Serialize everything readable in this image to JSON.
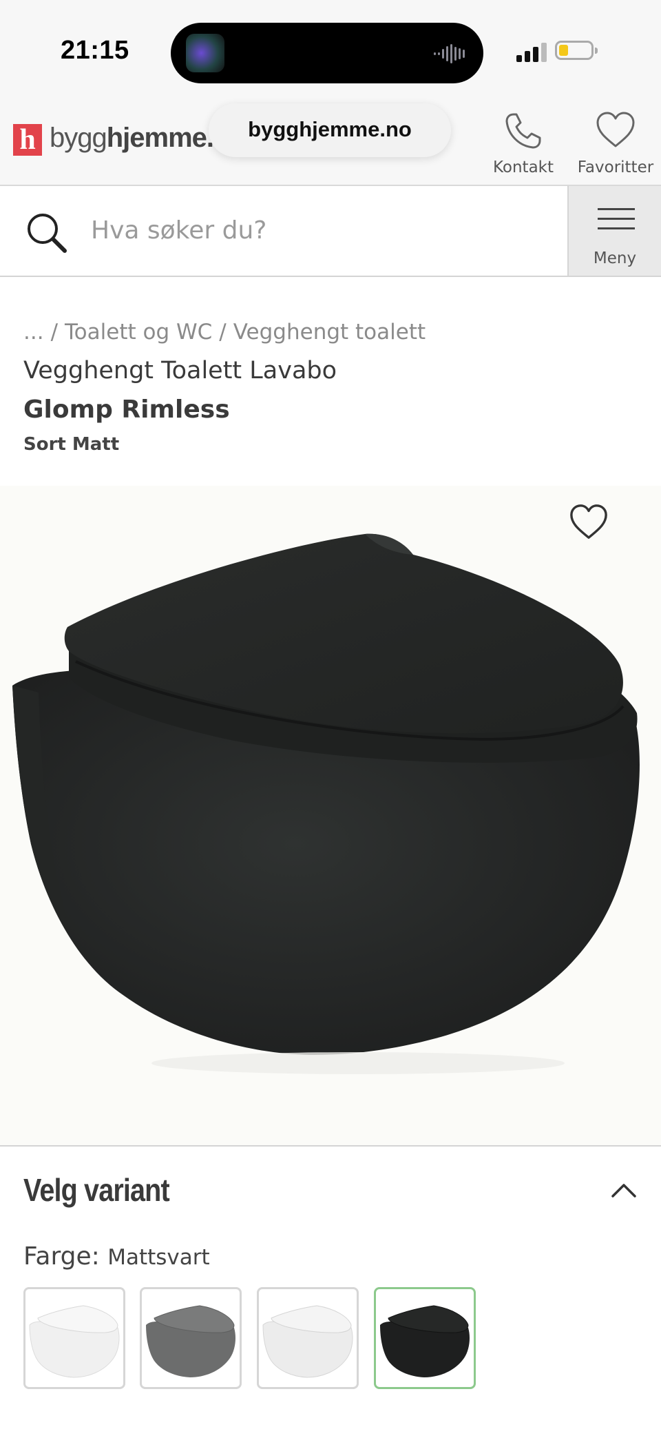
{
  "status_bar": {
    "time": "21:15"
  },
  "header": {
    "logo_letter": "h",
    "logo_text_plain": "bygg",
    "logo_text_bold": "hjemme.n",
    "url": "bygghjemme.no",
    "contact_label": "Kontakt",
    "favorites_label": "Favoritter"
  },
  "search": {
    "placeholder": "Hva søker du?",
    "menu_label": "Meny"
  },
  "breadcrumb": {
    "ellipsis": "...",
    "items": [
      "Toalett og WC",
      "Vegghengt toalett"
    ]
  },
  "product": {
    "subtitle": "Vegghengt Toalett Lavabo",
    "title": "Glomp Rimless",
    "color_tag": "Sort Matt"
  },
  "variant": {
    "heading": "Velg variant",
    "color_label": "Farge:",
    "color_value": "Mattsvart",
    "swatches": [
      {
        "name": "white",
        "color": "#f2f2f2",
        "selected": false
      },
      {
        "name": "grey",
        "color": "#6e6e6e",
        "selected": false
      },
      {
        "name": "white-2",
        "color": "#ededed",
        "selected": false
      },
      {
        "name": "black",
        "color": "#1e1f1f",
        "selected": true
      }
    ]
  },
  "colors": {
    "brand_red": "#e2434b",
    "selected_border": "#8cc98c",
    "toilet_black": "#262827"
  }
}
